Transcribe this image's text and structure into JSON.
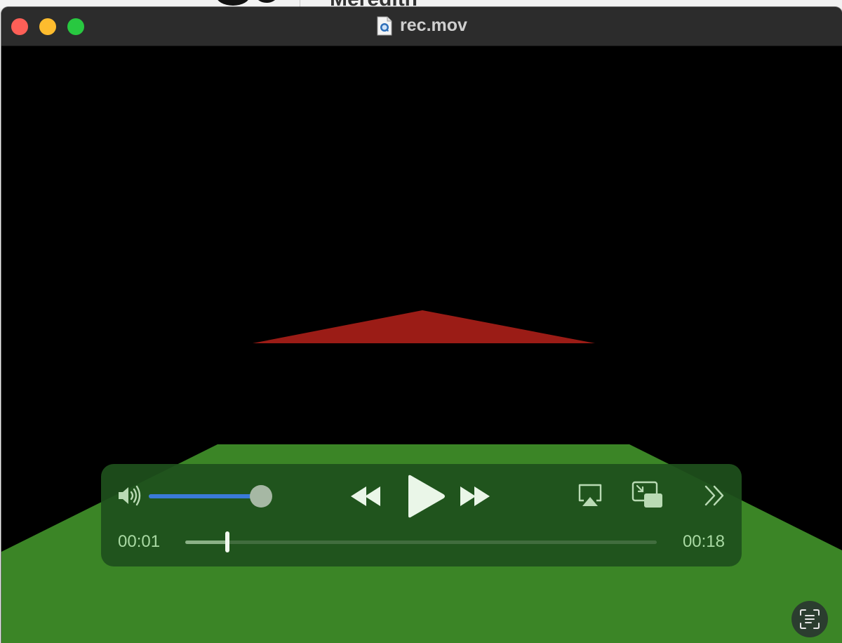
{
  "background": {
    "partial_text": "Meredith"
  },
  "window": {
    "title": "rec.mov",
    "file_icon": "quicktime-document-icon"
  },
  "controls": {
    "volume_level": 1.0,
    "current_time": "00:01",
    "total_time": "00:18",
    "playback_progress": 0.09,
    "icons": {
      "volume": "speaker-volume-icon",
      "rewind": "rewind-icon",
      "play": "play-icon",
      "fast_forward": "fast-forward-icon",
      "airplay": "airplay-icon",
      "pip": "picture-in-picture-icon",
      "more": "chevron-double-right-icon",
      "live_text": "live-text-icon"
    }
  },
  "colors": {
    "accent": "#3a7ad8",
    "controls_bg": "#1e501c",
    "time_text": "#a9d9a3",
    "scene_red": "#9b1c16",
    "scene_green": "#3b8526"
  }
}
